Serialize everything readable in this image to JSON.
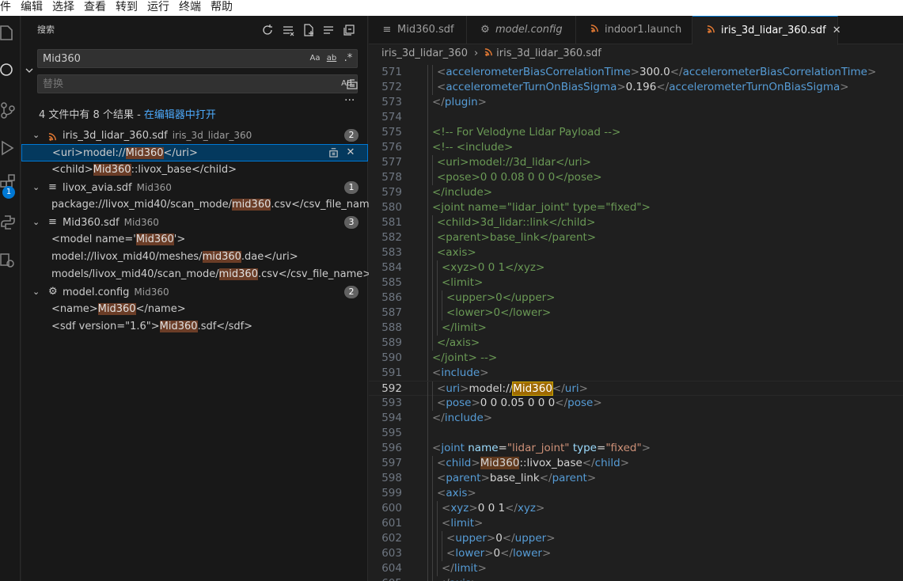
{
  "menu": [
    "件",
    "编辑",
    "选择",
    "查看",
    "转到",
    "运行",
    "终端",
    "帮助"
  ],
  "activity": {
    "icons": [
      "explorer-icon",
      "search-icon",
      "source-control-icon",
      "run-debug-icon",
      "extensions-icon",
      "python-icon",
      "remote-icon"
    ],
    "extensions_badge": "1"
  },
  "sidebar": {
    "title": "搜索",
    "search_value": "Mid360",
    "replace_placeholder": "替换",
    "options": {
      "match_case": "Aa",
      "whole_word": "ab",
      "regex": ".*",
      "preserve_case": "AB"
    },
    "more": "···",
    "summary_prefix": "4 文件中有 8 个结果 - ",
    "summary_link": "在编辑器中打开",
    "files": [
      {
        "name": "iris_3d_lidar_360.sdf",
        "path": "iris_3d_lidar_360",
        "count": "2",
        "matches": [
          {
            "pre": "<uri>model://",
            "hit": "Mid360",
            "post": "</uri>"
          },
          {
            "pre": "<child>",
            "hit": "Mid360",
            "post": "::livox_base</child>"
          }
        ]
      },
      {
        "name": "livox_avia.sdf",
        "path": "Mid360",
        "count": "1",
        "matches": [
          {
            "pre": "package://livox_mid40/scan_mode/",
            "hit": "mid360",
            "post": ".csv</csv_file_name>"
          }
        ]
      },
      {
        "name": "Mid360.sdf",
        "path": "Mid360",
        "count": "3",
        "matches": [
          {
            "pre": "<model name='",
            "hit": "Mid360",
            "post": "'>"
          },
          {
            "pre": "model://livox_mid40/meshes/",
            "hit": "mid360",
            "post": ".dae</uri>"
          },
          {
            "pre": "models/livox_mid40/scan_mode/",
            "hit": "mid360",
            "post": ".csv</csv_file_name>"
          }
        ]
      },
      {
        "name": "model.config",
        "path": "Mid360",
        "count": "2",
        "matches": [
          {
            "pre": "<name>",
            "hit": "Mid360",
            "post": "</name>"
          },
          {
            "pre": "<sdf version=\"1.6\">",
            "hit": "Mid360",
            "post": ".sdf</sdf>"
          }
        ]
      }
    ]
  },
  "tabs": [
    {
      "label": "Mid360.sdf",
      "icon": "≡",
      "italic": false
    },
    {
      "label": "model.config",
      "icon": "⚙",
      "italic": true
    },
    {
      "label": "indoor1.launch",
      "icon": "rss",
      "italic": false
    },
    {
      "label": "iris_3d_lidar_360.sdf",
      "icon": "rss",
      "italic": false,
      "close": "✕"
    }
  ],
  "breadcrumb": {
    "folder": "iris_3d_lidar_360",
    "file": "iris_3d_lidar_360.sdf"
  },
  "code": {
    "current_line": 592,
    "lines": [
      {
        "n": "571",
        "d": 1,
        "t": [
          [
            "br",
            "<"
          ],
          [
            "tag",
            "accelerometerBiasCorrelationTime"
          ],
          [
            "br",
            ">"
          ],
          [
            "txt",
            "300.0"
          ],
          [
            "br",
            "</"
          ],
          [
            "tag",
            "accelerometerBiasCorrelationTime"
          ],
          [
            "br",
            ">"
          ]
        ]
      },
      {
        "n": "572",
        "d": 1,
        "t": [
          [
            "br",
            "<"
          ],
          [
            "tag",
            "accelerometerTurnOnBiasSigma"
          ],
          [
            "br",
            ">"
          ],
          [
            "txt",
            "0.196"
          ],
          [
            "br",
            "</"
          ],
          [
            "tag",
            "accelerometerTurnOnBiasSigma"
          ],
          [
            "br",
            ">"
          ]
        ]
      },
      {
        "n": "573",
        "d": 0,
        "t": [
          [
            "br",
            "</"
          ],
          [
            "tag",
            "plugin"
          ],
          [
            "br",
            ">"
          ]
        ]
      },
      {
        "n": "574",
        "d": 0,
        "t": []
      },
      {
        "n": "575",
        "d": 0,
        "t": [
          [
            "cmt",
            "<!-- For Velodyne Lidar Payload -->"
          ]
        ]
      },
      {
        "n": "576",
        "d": 0,
        "t": [
          [
            "cmt",
            "<!-- <include>"
          ]
        ]
      },
      {
        "n": "577",
        "d": 1,
        "t": [
          [
            "cmt",
            "<uri>model://3d_lidar</uri>"
          ]
        ]
      },
      {
        "n": "578",
        "d": 1,
        "t": [
          [
            "cmt",
            "<pose>0 0 0.08 0 0 0</pose>"
          ]
        ]
      },
      {
        "n": "579",
        "d": 0,
        "t": [
          [
            "cmt",
            "</include>"
          ]
        ]
      },
      {
        "n": "580",
        "d": 0,
        "t": [
          [
            "cmt",
            "<joint name=\"lidar_joint\" type=\"fixed\">"
          ]
        ]
      },
      {
        "n": "581",
        "d": 1,
        "t": [
          [
            "cmt",
            "<child>3d_lidar::link</child>"
          ]
        ]
      },
      {
        "n": "582",
        "d": 1,
        "t": [
          [
            "cmt",
            "<parent>base_link</parent>"
          ]
        ]
      },
      {
        "n": "583",
        "d": 1,
        "t": [
          [
            "cmt",
            "<axis>"
          ]
        ]
      },
      {
        "n": "584",
        "d": 2,
        "t": [
          [
            "cmt",
            "<xyz>0 0 1</xyz>"
          ]
        ]
      },
      {
        "n": "585",
        "d": 2,
        "t": [
          [
            "cmt",
            "<limit>"
          ]
        ]
      },
      {
        "n": "586",
        "d": 3,
        "t": [
          [
            "cmt",
            "<upper>0</upper>"
          ]
        ]
      },
      {
        "n": "587",
        "d": 3,
        "t": [
          [
            "cmt",
            "<lower>0</lower>"
          ]
        ]
      },
      {
        "n": "588",
        "d": 2,
        "t": [
          [
            "cmt",
            "</limit>"
          ]
        ]
      },
      {
        "n": "589",
        "d": 1,
        "t": [
          [
            "cmt",
            "</axis>"
          ]
        ]
      },
      {
        "n": "590",
        "d": 0,
        "t": [
          [
            "cmt",
            "</joint> -->"
          ]
        ]
      },
      {
        "n": "591",
        "d": 0,
        "t": [
          [
            "br",
            "<"
          ],
          [
            "tag",
            "include"
          ],
          [
            "br",
            ">"
          ]
        ]
      },
      {
        "n": "592",
        "d": 1,
        "t": [
          [
            "br",
            "<"
          ],
          [
            "tag",
            "uri"
          ],
          [
            "br",
            ">"
          ],
          [
            "txt",
            "model://"
          ],
          [
            "hlcur",
            "Mid360"
          ],
          [
            "br",
            "</"
          ],
          [
            "tag",
            "uri"
          ],
          [
            "br",
            ">"
          ]
        ]
      },
      {
        "n": "593",
        "d": 1,
        "t": [
          [
            "br",
            "<"
          ],
          [
            "tag",
            "pose"
          ],
          [
            "br",
            ">"
          ],
          [
            "txt",
            "0 0 0.05 0 0 0"
          ],
          [
            "br",
            "</"
          ],
          [
            "tag",
            "pose"
          ],
          [
            "br",
            ">"
          ]
        ]
      },
      {
        "n": "594",
        "d": 0,
        "t": [
          [
            "br",
            "</"
          ],
          [
            "tag",
            "include"
          ],
          [
            "br",
            ">"
          ]
        ]
      },
      {
        "n": "595",
        "d": 0,
        "t": []
      },
      {
        "n": "596",
        "d": 0,
        "t": [
          [
            "br",
            "<"
          ],
          [
            "tag",
            "joint"
          ],
          [
            "txt",
            " "
          ],
          [
            "attr",
            "name"
          ],
          [
            "txt",
            "="
          ],
          [
            "val",
            "\"lidar_joint\""
          ],
          [
            "txt",
            " "
          ],
          [
            "attr",
            "type"
          ],
          [
            "txt",
            "="
          ],
          [
            "val",
            "\"fixed\""
          ],
          [
            "br",
            ">"
          ]
        ]
      },
      {
        "n": "597",
        "d": 1,
        "t": [
          [
            "br",
            "<"
          ],
          [
            "tag",
            "child"
          ],
          [
            "br",
            ">"
          ],
          [
            "hl",
            "Mid360"
          ],
          [
            "txt",
            "::livox_base"
          ],
          [
            "br",
            "</"
          ],
          [
            "tag",
            "child"
          ],
          [
            "br",
            ">"
          ]
        ]
      },
      {
        "n": "598",
        "d": 1,
        "t": [
          [
            "br",
            "<"
          ],
          [
            "tag",
            "parent"
          ],
          [
            "br",
            ">"
          ],
          [
            "txt",
            "base_link"
          ],
          [
            "br",
            "</"
          ],
          [
            "tag",
            "parent"
          ],
          [
            "br",
            ">"
          ]
        ]
      },
      {
        "n": "599",
        "d": 1,
        "t": [
          [
            "br",
            "<"
          ],
          [
            "tag",
            "axis"
          ],
          [
            "br",
            ">"
          ]
        ]
      },
      {
        "n": "600",
        "d": 2,
        "t": [
          [
            "br",
            "<"
          ],
          [
            "tag",
            "xyz"
          ],
          [
            "br",
            ">"
          ],
          [
            "txt",
            "0 0 1"
          ],
          [
            "br",
            "</"
          ],
          [
            "tag",
            "xyz"
          ],
          [
            "br",
            ">"
          ]
        ]
      },
      {
        "n": "601",
        "d": 2,
        "t": [
          [
            "br",
            "<"
          ],
          [
            "tag",
            "limit"
          ],
          [
            "br",
            ">"
          ]
        ]
      },
      {
        "n": "602",
        "d": 3,
        "t": [
          [
            "br",
            "<"
          ],
          [
            "tag",
            "upper"
          ],
          [
            "br",
            ">"
          ],
          [
            "txt",
            "0"
          ],
          [
            "br",
            "</"
          ],
          [
            "tag",
            "upper"
          ],
          [
            "br",
            ">"
          ]
        ]
      },
      {
        "n": "603",
        "d": 3,
        "t": [
          [
            "br",
            "<"
          ],
          [
            "tag",
            "lower"
          ],
          [
            "br",
            ">"
          ],
          [
            "txt",
            "0"
          ],
          [
            "br",
            "</"
          ],
          [
            "tag",
            "lower"
          ],
          [
            "br",
            ">"
          ]
        ]
      },
      {
        "n": "604",
        "d": 2,
        "t": [
          [
            "br",
            "</"
          ],
          [
            "tag",
            "limit"
          ],
          [
            "br",
            ">"
          ]
        ]
      },
      {
        "n": "605",
        "d": 1,
        "t": [
          [
            "br",
            "</"
          ],
          [
            "tag",
            "axis"
          ],
          [
            "br",
            ">"
          ]
        ]
      }
    ]
  }
}
